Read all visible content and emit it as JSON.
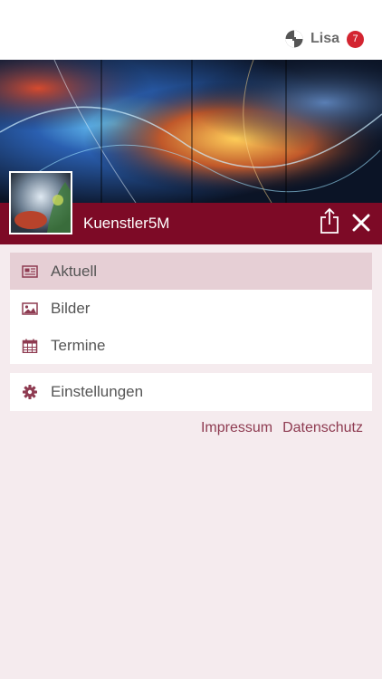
{
  "header": {
    "username": "Lisa",
    "notification_count": "7",
    "logo_icon": "checkered-logo-icon"
  },
  "profile": {
    "name": "Kuenstler5M",
    "share_icon": "share-icon",
    "close_icon": "close-icon"
  },
  "menu": {
    "items": [
      {
        "label": "Aktuell",
        "icon": "newspaper-icon",
        "active": true
      },
      {
        "label": "Bilder",
        "icon": "image-icon",
        "active": false
      },
      {
        "label": "Termine",
        "icon": "calendar-icon",
        "active": false
      }
    ]
  },
  "settings": {
    "label": "Einstellungen",
    "icon": "gear-icon"
  },
  "footer": {
    "impressum": "Impressum",
    "datenschutz": "Datenschutz"
  },
  "colors": {
    "accent": "#7d0a26",
    "active_bg": "#e6cfd5",
    "page_bg": "#f5ebee",
    "link": "#8e3b51",
    "badge": "#d32430"
  }
}
